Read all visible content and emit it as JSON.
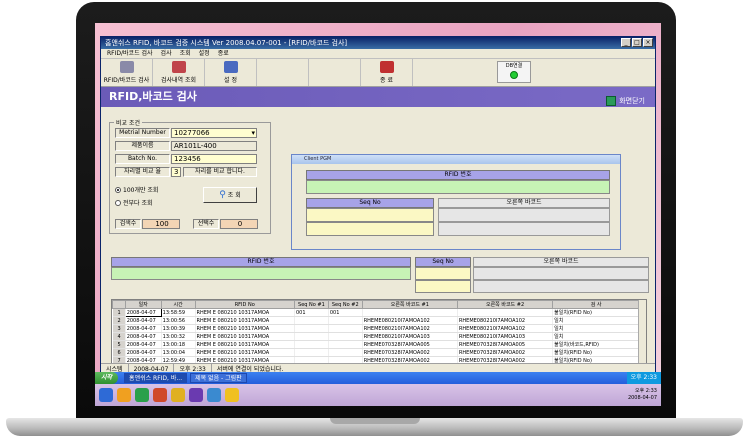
{
  "window": {
    "title": "홈앤쉬스 RFID, 바코드 검증 시스템 Ver 2008.04.07-001 - [RFID/바코드 검사]"
  },
  "menu": [
    "RFID/바코드 검사",
    "검사",
    "조회",
    "설정",
    "종료"
  ],
  "toolbar": [
    {
      "label": "RFID/바코드 검사",
      "icon": "barcode-scanner-icon",
      "color": "#8a8aa8"
    },
    {
      "label": "검사내역 조회",
      "icon": "chart-icon",
      "color": "#c0444a"
    },
    {
      "label": "설 정",
      "icon": "gear-icon",
      "color": "#4a6ac0"
    },
    {
      "label": "",
      "icon": "blank",
      "color": "#ece9d8"
    },
    {
      "label": "",
      "icon": "blank",
      "color": "#ece9d8"
    },
    {
      "label": "종 료",
      "icon": "exit-icon",
      "color": "#c03030"
    }
  ],
  "db": {
    "label": "DB연결",
    "color": "#22cc33"
  },
  "banner": {
    "title": "RFID,바코드 검사",
    "close_label": "화면닫기"
  },
  "compare": {
    "group_label": "비교 조건",
    "material_label": "Metrial Number",
    "material_value": "10277066",
    "product_label": "제품이름",
    "product_value": "AR101L-400",
    "batch_label": "Batch No.",
    "batch_value": "123456",
    "digits_label": "자리별 비교 율",
    "digits_value": "3",
    "digits_note": "자리를 비교 합니다.",
    "radio1": "100개만 조회",
    "radio2": "전부다 조회",
    "search_label": "조 회",
    "check_count_label": "검색수",
    "check_count_value": "100",
    "select_count_label": "선택수",
    "select_count_value": "0"
  },
  "popup": {
    "title": "Client PGM",
    "rfid_header": "RFID 번호",
    "seq_header": "Seq No",
    "right_header": "오른쪽 바코드"
  },
  "main": {
    "rfid_header": "RFID 번호",
    "seq_header": "Seq No",
    "right_header": "오른쪽 바코드"
  },
  "grid": {
    "columns": [
      "",
      "일자",
      "시간",
      "RFID No",
      "Seq No #1",
      "Seq No #2",
      "오른쪽 바코드 #1",
      "오른쪽 바코드 #2",
      "검 사"
    ],
    "rows": [
      [
        "1",
        "2008-04-07",
        "13:58:59",
        "RHEM  E   080210  10317AMOA",
        "001",
        "001",
        "",
        "",
        "불일치(RFID No)"
      ],
      [
        "2",
        "2008-04-07",
        "13:00:56",
        "RHEM  E   080210  10317AMOA",
        "",
        "",
        "RHEME080210I7AMOA102",
        "RHEME080210I7AMOA102",
        "일치"
      ],
      [
        "3",
        "2008-04-07",
        "13:00:39",
        "RHEM  E   080210  10317AMOA",
        "",
        "",
        "RHEME080210I7AMOA102",
        "RHEME080210I7AMOA102",
        "일치"
      ],
      [
        "4",
        "2008-04-07",
        "13:00:32",
        "RHEM  E   080210  10317AMOA",
        "",
        "",
        "RHEME080210I7AMOA103",
        "RHEME080210I7AMOA103",
        "일치"
      ],
      [
        "5",
        "2008-04-07",
        "13:00:18",
        "RHEM  E   080210  10317AMOA",
        "",
        "",
        "RHEME070328I7AMOA005",
        "RHEME070328I7AMOA005",
        "불일치(바코드,RFID)"
      ],
      [
        "6",
        "2008-04-07",
        "13:00:04",
        "RHEM  E   080210  10317AMOA",
        "",
        "",
        "RHEME070328I7AMOA002",
        "RHEME070328I7AMOA002",
        "불일치(RFID No)"
      ],
      [
        "7",
        "2008-04-07",
        "12:59:49",
        "RHEM  E   080210  10317AMOA",
        "",
        "",
        "RHEME070328I7AMOA002",
        "RHEME070328I7AMOA002",
        "불일치(RFID No)"
      ],
      [
        "8",
        "2008-04-07",
        "12:59:43",
        "RHEM  E   080210  10317AMOA",
        "",
        "",
        "RHEME080210I7AMOA102",
        "RHEME080210I7AMOA102",
        "일치"
      ]
    ]
  },
  "status": {
    "system": "시스템",
    "date": "2008-04-07",
    "time": "오후 2:33",
    "message": "서버에 연결이 되었습니다."
  },
  "taskbar": {
    "start": "시작",
    "tasks": [
      "홈앤쉬스 RFID, 바...",
      "제목 없음 - 그림판"
    ],
    "clock": "오후 2:33"
  },
  "taskbar2": {
    "time": "오후 2:33",
    "date": "2008-04-07",
    "icon_colors": [
      "#2e6ad6",
      "#f0a020",
      "#2aa04a",
      "#d04a2a",
      "#e0b020",
      "#6a3ab0",
      "#3a8ad0",
      "#f0c020"
    ]
  }
}
